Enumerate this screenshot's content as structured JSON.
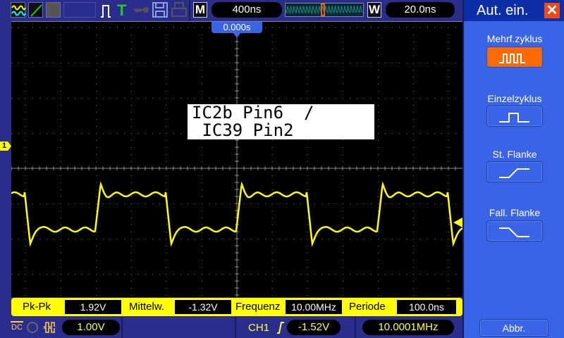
{
  "toolbar": {
    "icons": [
      "waveform-icon",
      "line-icon",
      "persistence-icon",
      "blank-box",
      "trigger-pulse-icon",
      "trigger-t-icon",
      "key-icon",
      "save-icon",
      "print-icon"
    ],
    "mode_badge": "M",
    "timebase": "400ns",
    "window_badge": "W",
    "window_timebase": "20.0ns",
    "window_position_fraction": 0.48
  },
  "screen": {
    "trigger_position": "0.000s",
    "channel_marker": "1",
    "label_line1": "IC2b Pin6  /",
    "label_line2": " IC39 Pin2",
    "trace_color": "#ffff00"
  },
  "measurements": [
    {
      "label": "Pk-Pk",
      "value": "1.92V"
    },
    {
      "label": "Mittelw.",
      "value": "-1.32V"
    },
    {
      "label": "Frequenz",
      "value": "10.00MHz"
    },
    {
      "label": "Periode",
      "value": "100.0ns"
    }
  ],
  "status": {
    "coupling": "DC",
    "volts_per_div": "1.00V",
    "trigger_source": "CH1",
    "trigger_level": "-1.52V",
    "trigger_frequency": "10.0001MHz"
  },
  "side_menu": {
    "title": "Aut. ein.",
    "items": [
      {
        "label": "Mehrf.zyklus",
        "active": true
      },
      {
        "label": "Einzelzyklus",
        "active": false
      },
      {
        "label": "St.  Flanke",
        "active": false
      },
      {
        "label": "Fall.  Flanke",
        "active": false
      }
    ],
    "cancel": "Abbr."
  },
  "colors": {
    "accent": "#ff6a00",
    "menu": "#3a64e8",
    "trace": "#ffff00",
    "close": "#f04818"
  }
}
